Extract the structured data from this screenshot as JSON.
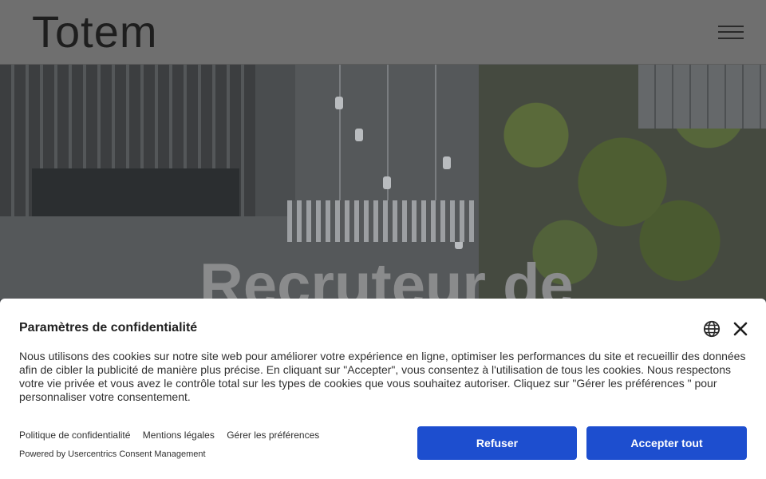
{
  "header": {
    "logo_text": "Totem",
    "menu_icon": "hamburger-menu-icon"
  },
  "hero": {
    "title": "Recruteur de"
  },
  "consent": {
    "title": "Paramètres de confidentialité",
    "globe_icon": "globe-icon",
    "close_icon": "close-icon",
    "body": "Nous utilisons des cookies sur notre site web pour améliorer votre expérience en ligne, optimiser les performances du site et recueillir des données afin de cibler la publicité de manière plus précise. En cliquant sur \"Accepter\", vous consentez à l'utilisation de tous les cookies. Nous respectons votre vie privée et vous avez le contrôle total sur les types de cookies que vous souhaitez autoriser. Cliquez sur \"Gérer les préférences \" pour personnaliser votre consentement.",
    "links": {
      "privacy": "Politique de confidentialité",
      "legal": "Mentions légales",
      "preferences": "Gérer les préférences"
    },
    "powered_by": "Powered by Usercentrics Consent Management",
    "buttons": {
      "refuse": "Refuser",
      "accept": "Accepter tout"
    },
    "button_color": "#1d4ecf"
  }
}
